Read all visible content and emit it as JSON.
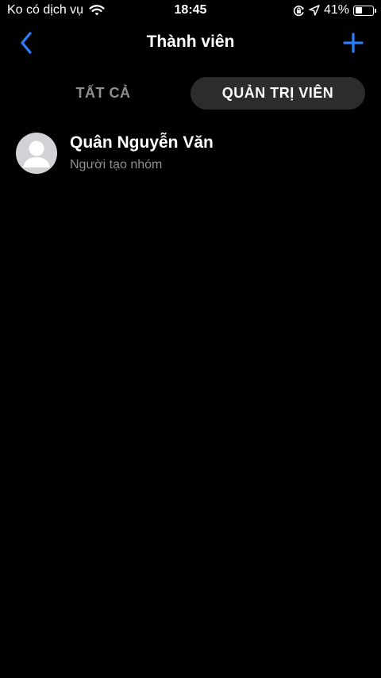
{
  "status_bar": {
    "carrier": "Ko có dịch vụ",
    "time": "18:45",
    "battery_percent": "41%",
    "battery_level": 0.41,
    "icons": [
      "wifi-icon",
      "orientation-lock-icon",
      "location-arrow-icon",
      "battery-icon"
    ]
  },
  "nav": {
    "title": "Thành viên",
    "back_icon": "chevron-left-icon",
    "add_icon": "plus-icon"
  },
  "tabs": [
    {
      "label": "TẤT CẢ",
      "selected": false
    },
    {
      "label": "QUẢN TRỊ VIÊN",
      "selected": true
    }
  ],
  "members": [
    {
      "name": "Quân Nguyễn Văn",
      "role": "Người tạo nhóm",
      "avatar_icon": "default-avatar-icon"
    }
  ],
  "colors": {
    "accent": "#2d7ff9",
    "background": "#000000",
    "secondary_text": "#8e8e93",
    "selected_tab_bg": "#2c2c2e",
    "avatar_bg": "#d1d1d6"
  }
}
